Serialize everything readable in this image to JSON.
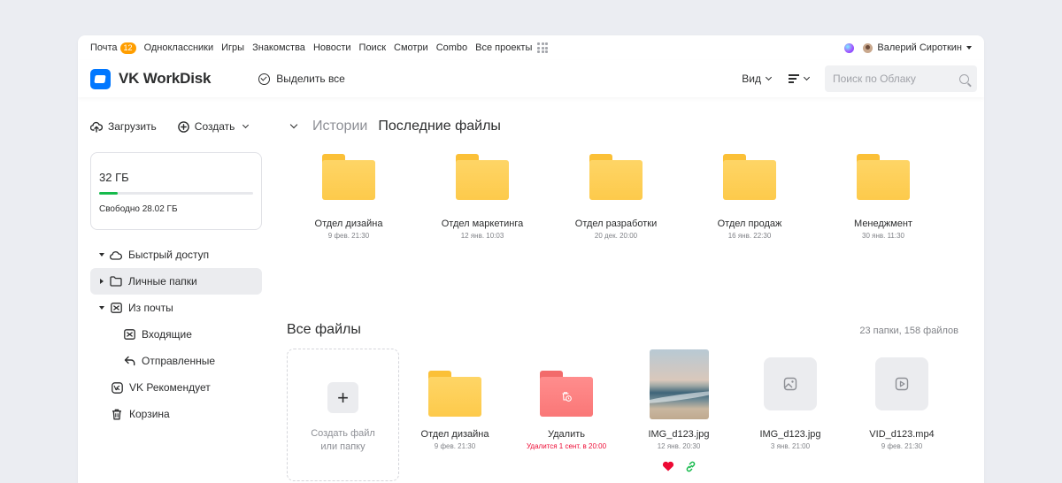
{
  "portal": {
    "links": [
      {
        "label": "Почта",
        "badge": "12"
      },
      {
        "label": "Одноклассники"
      },
      {
        "label": "Игры"
      },
      {
        "label": "Знакомства"
      },
      {
        "label": "Новости"
      },
      {
        "label": "Поиск"
      },
      {
        "label": "Смотри"
      },
      {
        "label": "Combo"
      },
      {
        "label": "Все проекты"
      }
    ],
    "user_name": "Валерий Сироткин"
  },
  "header": {
    "logo": "VK WorkDisk",
    "select_all": "Выделить все",
    "view_label": "Вид",
    "search_placeholder": "Поиск по Облаку"
  },
  "sidebar": {
    "upload_label": "Загрузить",
    "create_label": "Создать",
    "storage": {
      "total": "32 ГБ",
      "free": "Свободно 28.02 ГБ",
      "used_fraction": 0.12
    },
    "items": [
      {
        "label": "Быстрый доступ",
        "icon": "cloud-icon",
        "expand": "down"
      },
      {
        "label": "Личные папки",
        "icon": "folder-icon",
        "expand": "right",
        "active": true
      },
      {
        "label": "Из почты",
        "icon": "mail-icon",
        "expand": "down"
      },
      {
        "label": "Входящие",
        "icon": "mail-icon",
        "sub": true
      },
      {
        "label": "Отправленные",
        "icon": "reply-icon",
        "sub": true
      },
      {
        "label": "VK Рекомендует",
        "icon": "vk-icon"
      },
      {
        "label": "Корзина",
        "icon": "trash-icon"
      }
    ]
  },
  "main": {
    "tab_stories": "Истории",
    "tab_recent": "Последние файлы",
    "recent": [
      {
        "name": "Отдел дизайна",
        "date": "9 фев. 21:30"
      },
      {
        "name": "Отдел маркетинга",
        "date": "12 янв. 10:03"
      },
      {
        "name": "Отдел разработки",
        "date": "20 дек. 20:00"
      },
      {
        "name": "Отдел продаж",
        "date": "16 янв. 22:30"
      },
      {
        "name": "Менеджмент",
        "date": "30 янв. 11:30"
      }
    ],
    "all_title": "Все файлы",
    "all_count": "23 папки, 158 файлов",
    "create_text_1": "Создать файл",
    "create_text_2": "или папку",
    "files": [
      {
        "name": "Отдел дизайна",
        "date": "9 фев. 21:30",
        "kind": "folder"
      },
      {
        "name": "Удалить",
        "date": "Удалится 1 сент. в 20:00",
        "kind": "deleted-folder"
      },
      {
        "name": "IMG_d123.jpg",
        "date": "12 янв. 20:30",
        "kind": "photo"
      },
      {
        "name": "IMG_d123.jpg",
        "date": "3 янв. 21:00",
        "kind": "image"
      },
      {
        "name": "VID_d123.mp4",
        "date": "9 фев. 21:30",
        "kind": "video"
      }
    ]
  },
  "colors": {
    "accent": "#0077ff",
    "folder": "#fdca4b",
    "deleted_folder": "#fa7777",
    "storage_bar": "#16ba4c",
    "warning": "#ed0a34"
  }
}
